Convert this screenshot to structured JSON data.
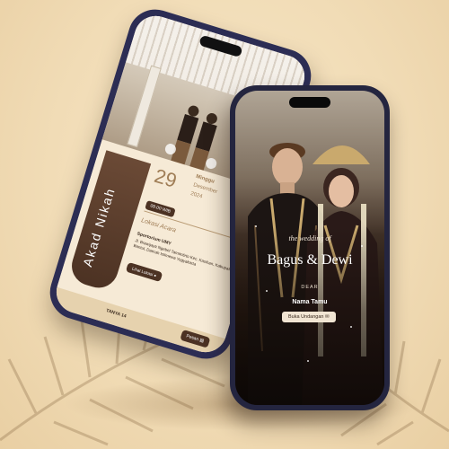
{
  "back_phone": {
    "event_title": "Akad Nikah",
    "date": {
      "day": "29",
      "weekday": "Minggu",
      "month": "Desember",
      "year": "2024"
    },
    "time": "09.00 WIB",
    "location_heading": "Lokasi Acara",
    "venue": "Sportorium UMY",
    "address": "Jl. Brawijaya Ngebel Tamantirto Kec. Kasihan, Kabupaten Bantul, Daerah Istimewa Yogyakarta",
    "location_button": "Lihat Lokasi",
    "bottom_bar": {
      "ask": "TANYA 14",
      "order": "Pesan"
    }
  },
  "front_phone": {
    "subtitle": "the wedding of",
    "couple_names": "Bagus & Dewi",
    "dear": "DEAR",
    "guest": "Nama Tamu",
    "open_button": "Buka Undangan"
  },
  "colors": {
    "brown": "#4c3223",
    "accent": "#a07e57",
    "background": "#f1dcb6",
    "phone_frame": "#2c2d54"
  }
}
